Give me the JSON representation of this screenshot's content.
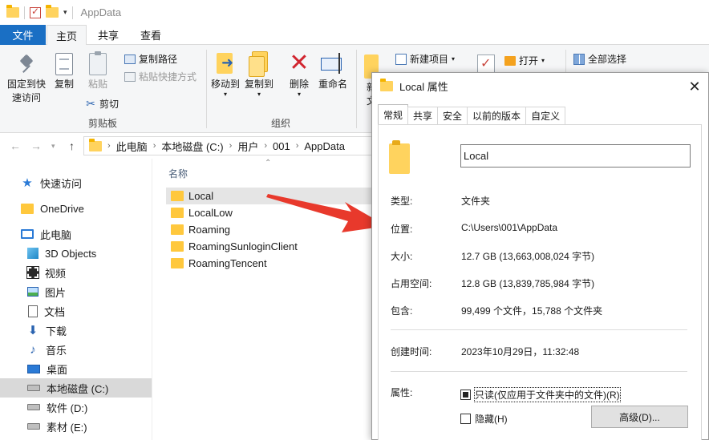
{
  "explorer": {
    "title": "AppData",
    "tabs": [
      "文件",
      "主页",
      "共享",
      "查看"
    ],
    "ribbon": {
      "pin": "固定到快\n速访问",
      "pin_line1": "固定到快",
      "pin_line2": "速访问",
      "copy": "复制",
      "paste": "粘贴",
      "copy_path": "复制路径",
      "paste_shortcut": "粘贴快捷方式",
      "cut": "剪切",
      "clipboard_group": "剪贴板",
      "move_to": "移动到",
      "copy_to": "复制到",
      "delete": "删除",
      "rename": "重命名",
      "organize_group": "组织",
      "new_item": "新建项目",
      "new_partial": "新",
      "new_partial2": "文",
      "open": "打开",
      "select_all": "全部选择"
    },
    "breadcrumb": [
      "此电脑",
      "本地磁盘 (C:)",
      "用户",
      "001",
      "AppData"
    ],
    "nav": [
      {
        "label": "快速访问",
        "icon": "star-icon"
      },
      {
        "label": "OneDrive",
        "icon": "folder-icon"
      },
      {
        "label": "此电脑",
        "icon": "computer-icon"
      },
      {
        "label": "3D Objects",
        "icon": "3d-objects-icon"
      },
      {
        "label": "视频",
        "icon": "video-icon"
      },
      {
        "label": "图片",
        "icon": "pictures-icon"
      },
      {
        "label": "文档",
        "icon": "documents-icon"
      },
      {
        "label": "下载",
        "icon": "download-icon"
      },
      {
        "label": "音乐",
        "icon": "music-icon"
      },
      {
        "label": "桌面",
        "icon": "desktop-icon"
      },
      {
        "label": "本地磁盘 (C:)",
        "icon": "drive-icon"
      },
      {
        "label": "软件 (D:)",
        "icon": "drive-icon"
      },
      {
        "label": "素材 (E:)",
        "icon": "drive-icon"
      }
    ],
    "column_name": "名称",
    "files": [
      "Local",
      "LocalLow",
      "Roaming",
      "RoamingSunloginClient",
      "RoamingTencent"
    ]
  },
  "dialog": {
    "title": "Local 属性",
    "tabs": [
      "常规",
      "共享",
      "安全",
      "以前的版本",
      "自定义"
    ],
    "name": "Local",
    "rows": {
      "type_label": "类型:",
      "type_value": "文件夹",
      "location_label": "位置:",
      "location_value": "C:\\Users\\001\\AppData",
      "size_label": "大小:",
      "size_value": "12.7 GB (13,663,008,024 字节)",
      "disk_label": "占用空间:",
      "disk_value": "12.8 GB (13,839,785,984 字节)",
      "contains_label": "包含:",
      "contains_value": "99,499 个文件，15,788 个文件夹",
      "created_label": "创建时间:",
      "created_value": "2023年10月29日，11:32:48",
      "attr_label": "属性:"
    },
    "readonly": "只读(仅应用于文件夹中的文件)(R)",
    "hidden": "隐藏(H)",
    "advanced": "高级(D)..."
  },
  "colors": {
    "accent": "#1a6fc4",
    "arrow": "#e8392c",
    "selection": "#d9d9d9"
  }
}
